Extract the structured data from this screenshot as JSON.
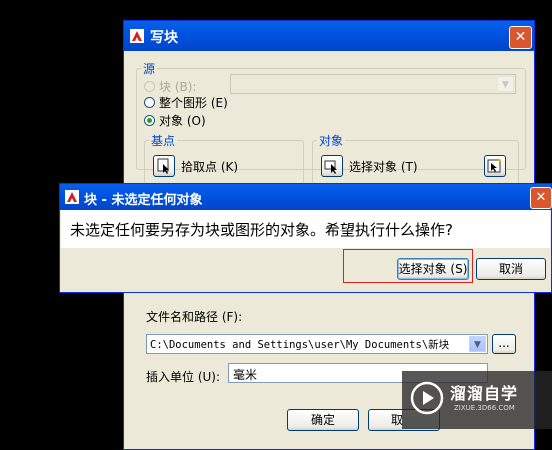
{
  "main_dialog": {
    "title": "写块",
    "source": {
      "group_title": "源",
      "radio_block": "块 (B):",
      "radio_entire": "整个图形 (E)",
      "radio_objects": "对象 (O)",
      "selected": "objects"
    },
    "base_point": {
      "group_title": "基点",
      "pick_button": "拾取点 (K)"
    },
    "objects": {
      "group_title": "对象",
      "select_button": "选择对象 (T)"
    },
    "destination": {
      "file_label": "文件名和路径 (F):",
      "file_path": "C:\\Documents and Settings\\user\\My Documents\\新块",
      "browse_button": "...",
      "units_label": "插入单位 (U):",
      "units_value": "毫米"
    },
    "footer": {
      "ok_button": "确定",
      "cancel_button": "取"
    }
  },
  "modal": {
    "title": "块 - 未选定任何对象",
    "message": "未选定任何要另存为块或图形的对象。希望执行什么操作?",
    "select_button": "选择对象 (S)",
    "cancel_button": "取消"
  },
  "watermark": {
    "brand": "溜溜自学",
    "url": "ZIXUE.3D66.COM"
  },
  "colors": {
    "titlebar": "#0054e3",
    "dialog_bg": "#ece9d8",
    "group_title": "#0046d5",
    "highlight_box": "#e02020"
  }
}
